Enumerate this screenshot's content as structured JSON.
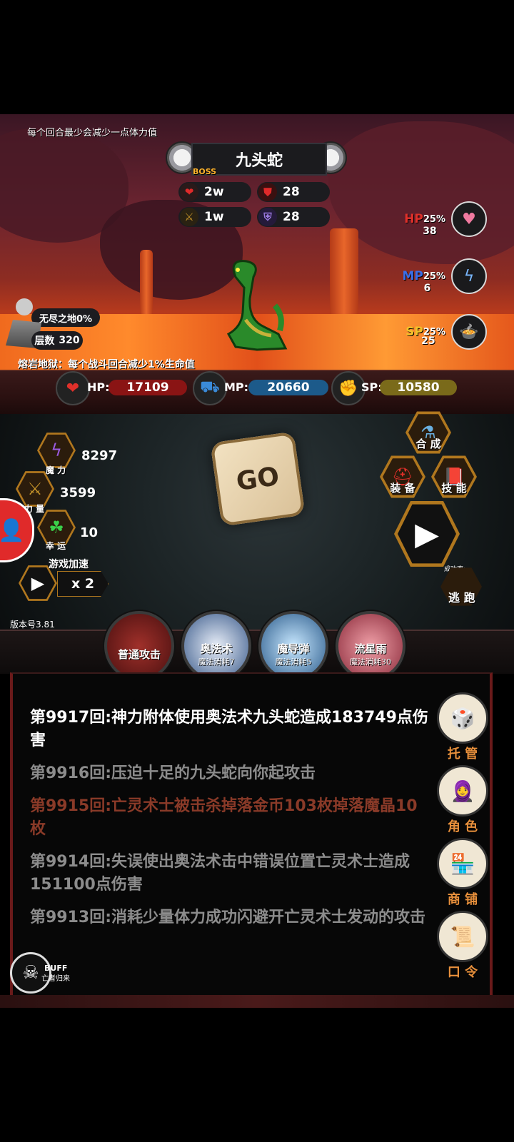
{
  "scene": {
    "hint_top": "每个回合最少会减少一点体力值",
    "boss_name": "九头蛇",
    "boss_tag": "BOSS",
    "boss_stats": {
      "hp": "2w",
      "defense": "28",
      "attack": "1w",
      "magic_def": "28"
    },
    "resources": [
      {
        "label": "HP",
        "pct": "25%",
        "value": "38",
        "color": "#e0302a",
        "icon": "heart-potion-icon"
      },
      {
        "label": "MP",
        "pct": "25%",
        "value": "6",
        "color": "#3a6ee8",
        "icon": "mana-potion-icon"
      },
      {
        "label": "SP",
        "pct": "25%",
        "value": "25",
        "color": "#f2c22a",
        "icon": "food-icon"
      }
    ],
    "zone_name": "无尽之地0%",
    "floor_label": "层数",
    "floor_value": "320",
    "lava_hint": "熔岩地狱：每个战斗回合减少1%生命值"
  },
  "player": {
    "hp_label": "HP:",
    "hp_value": "17109",
    "mp_label": "MP:",
    "mp_value": "20660",
    "sp_label": "SP:",
    "sp_value": "10580"
  },
  "attributes": [
    {
      "name": "魔 力",
      "value": "8297",
      "icon": "lightning-icon"
    },
    {
      "name": "力 量",
      "value": "3599",
      "icon": "sword-icon"
    },
    {
      "name": "幸 运",
      "value": "10",
      "icon": "clover-icon"
    }
  ],
  "speed": {
    "label": "游戏加速",
    "value": "x 2"
  },
  "dice_label": "GO",
  "menu": {
    "compose": "合 成",
    "equip": "装 备",
    "skill": "技 能"
  },
  "escape": {
    "label": "逃 跑",
    "rate_label": "成功率:",
    "rate_value": "0"
  },
  "version": "版本号3.81",
  "skills": [
    {
      "name": "普通攻击",
      "cost": "",
      "color": "#6a1a1a"
    },
    {
      "name": "奥法术",
      "cost": "魔法消耗7",
      "color": "#1f3a5a"
    },
    {
      "name": "魔导弹",
      "cost": "魔法消耗5",
      "color": "#1d4a6a"
    },
    {
      "name": "流星雨",
      "cost": "魔法消耗30",
      "color": "#5a1a2a"
    }
  ],
  "log": [
    {
      "text": "第9917回:神力附体使用奥法术九头蛇造成183749点伤害",
      "color": "#ffffff"
    },
    {
      "text": "第9916回:压迫十足的九头蛇向你起攻击",
      "color": "#8c8c8c"
    },
    {
      "text": "第9915回:亡灵术士被击杀掉落金币103枚掉落魔晶10枚",
      "color": "#8a3a28"
    },
    {
      "text": "第9914回:失误使出奥法术击中错误位置亡灵术士造成151100点伤害",
      "color": "#8c8c8c"
    },
    {
      "text": "第9913回:消耗少量体力成功闪避开亡灵术士发动的攻击",
      "color": "#8c8c8c"
    }
  ],
  "right_menu": [
    "托 管",
    "角 色",
    "商 铺",
    "口 令"
  ],
  "buff": {
    "label": "BUFF",
    "name": "亡者归来"
  }
}
